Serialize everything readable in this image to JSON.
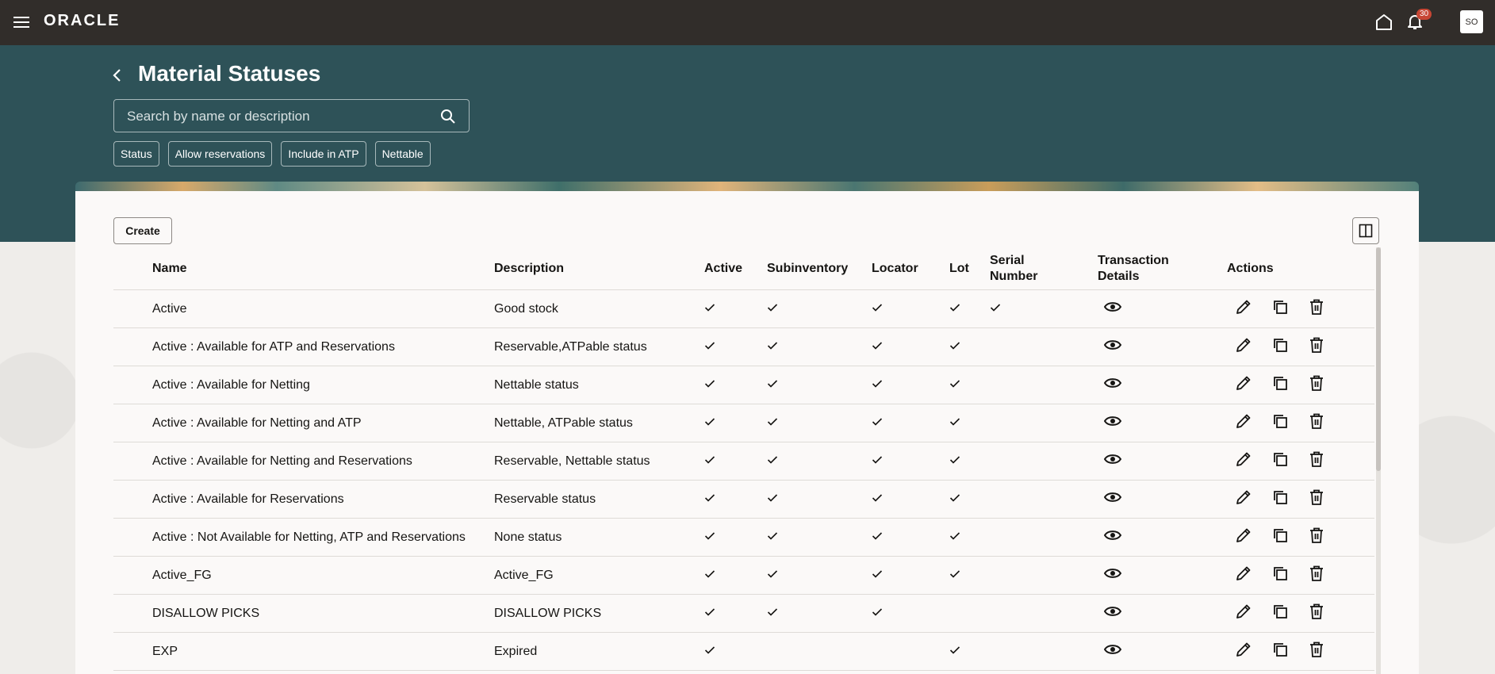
{
  "topbar": {
    "logo": "ORACLE",
    "notification_count": "30",
    "avatar_initials": "SO"
  },
  "header": {
    "title": "Material Statuses",
    "search_placeholder": "Search by name or description",
    "filters": [
      "Status",
      "Allow reservations",
      "Include in ATP",
      "Nettable"
    ]
  },
  "toolbar": {
    "create_label": "Create"
  },
  "table": {
    "columns": {
      "name": "Name",
      "description": "Description",
      "active": "Active",
      "subinventory": "Subinventory",
      "locator": "Locator",
      "lot": "Lot",
      "serial_1": "Serial",
      "serial_2": "Number",
      "transaction_1": "Transaction",
      "transaction_2": "Details",
      "actions": "Actions"
    },
    "rows": [
      {
        "name": "Active",
        "description": "Good stock",
        "active": true,
        "subinventory": true,
        "locator": true,
        "lot": true,
        "serial": true
      },
      {
        "name": "Active : Available for ATP and Reservations",
        "description": "Reservable,ATPable status",
        "active": true,
        "subinventory": true,
        "locator": true,
        "lot": true,
        "serial": false
      },
      {
        "name": "Active : Available for Netting",
        "description": "Nettable status",
        "active": true,
        "subinventory": true,
        "locator": true,
        "lot": true,
        "serial": false
      },
      {
        "name": "Active : Available for Netting and ATP",
        "description": "Nettable, ATPable status",
        "active": true,
        "subinventory": true,
        "locator": true,
        "lot": true,
        "serial": false
      },
      {
        "name": "Active : Available for Netting and Reservations",
        "description": "Reservable, Nettable status",
        "active": true,
        "subinventory": true,
        "locator": true,
        "lot": true,
        "serial": false
      },
      {
        "name": "Active : Available for Reservations",
        "description": "Reservable status",
        "active": true,
        "subinventory": true,
        "locator": true,
        "lot": true,
        "serial": false
      },
      {
        "name": "Active : Not Available for Netting, ATP and Reservations",
        "description": "None status",
        "active": true,
        "subinventory": true,
        "locator": true,
        "lot": true,
        "serial": false
      },
      {
        "name": "Active_FG",
        "description": "Active_FG",
        "active": true,
        "subinventory": true,
        "locator": true,
        "lot": true,
        "serial": false
      },
      {
        "name": "DISALLOW PICKS",
        "description": "DISALLOW PICKS",
        "active": true,
        "subinventory": true,
        "locator": true,
        "lot": false,
        "serial": false
      },
      {
        "name": "EXP",
        "description": "Expired",
        "active": true,
        "subinventory": false,
        "locator": false,
        "lot": true,
        "serial": false
      }
    ]
  }
}
